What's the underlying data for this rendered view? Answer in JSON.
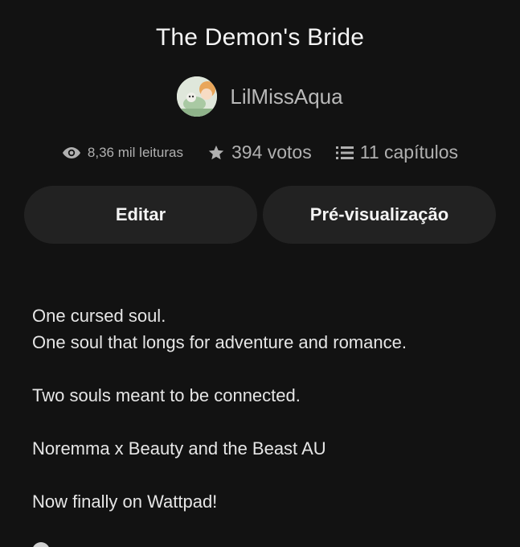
{
  "story": {
    "title": "The Demon's Bride",
    "author": "LilMissAqua"
  },
  "stats": {
    "reads": "8,36 mil leituras",
    "votes": "394 votos",
    "chapters": "11 capítulos"
  },
  "actions": {
    "edit_label": "Editar",
    "preview_label": "Pré-visualização"
  },
  "description": {
    "line1": "One cursed soul.",
    "line2": "One soul that longs for adventure and romance.",
    "line3": "Two souls meant to be connected.",
    "line4": "Noremma x Beauty and the Beast AU",
    "line5": "Now finally on Wattpad!"
  },
  "icons": {
    "reads": "eye-icon",
    "votes": "star-icon",
    "chapters": "list-icon"
  },
  "colors": {
    "background": "#121212",
    "button": "#222222",
    "muted_text": "#b0b0b0"
  }
}
